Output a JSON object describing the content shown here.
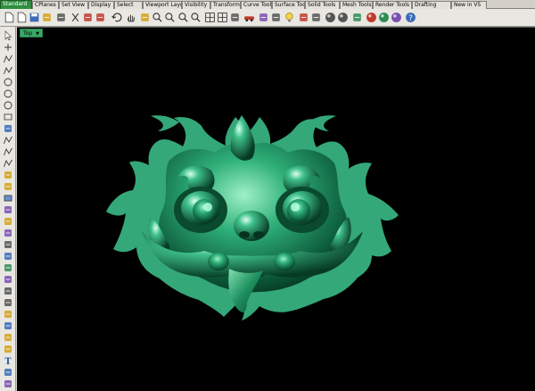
{
  "tabs": [
    {
      "label": "Standard",
      "active": true
    },
    {
      "label": "CPlanes",
      "active": false
    },
    {
      "label": "Set View",
      "active": false
    },
    {
      "label": "Display",
      "active": false
    },
    {
      "label": "Select",
      "active": false
    },
    {
      "label": "Viewport Layout",
      "active": false
    },
    {
      "label": "Visibility",
      "active": false
    },
    {
      "label": "Transform",
      "active": false
    },
    {
      "label": "Curve Tools",
      "active": false
    },
    {
      "label": "Surface Tools",
      "active": false
    },
    {
      "label": "Solid Tools",
      "active": false
    },
    {
      "label": "Mesh Tools",
      "active": false
    },
    {
      "label": "Render Tools",
      "active": false
    },
    {
      "label": "Drafting",
      "active": false
    },
    {
      "label": "New in V5",
      "active": false
    }
  ],
  "toolbar_icons": [
    "new-file-icon",
    "open-file-icon",
    "save-icon",
    "print-icon",
    "import-icon",
    "cut-icon",
    "copy-icon",
    "paste-icon",
    "undo-icon",
    "pan-hand-icon",
    "rotate-view-icon",
    "zoom-dynamic-icon",
    "zoom-window-icon",
    "zoom-extents-icon",
    "zoom-selected-icon",
    "four-viewports-icon",
    "grid-icon",
    "cplane-icon",
    "car-icon",
    "snap-icon",
    "layer-icon",
    "light-bulb-icon",
    "properties-icon",
    "lock-icon",
    "rendered-sphere-icon",
    "material-sphere-icon",
    "render-icon",
    "shaded-sphere-icon",
    "ghosted-sphere-icon",
    "xray-sphere-icon",
    "help-icon"
  ],
  "left_icons": [
    "select-arrow-icon",
    "point-icon",
    "polyline-icon",
    "curve-icon",
    "circle-icon",
    "arc-icon",
    "ellipse-icon",
    "rectangle-icon",
    "polygon-icon",
    "freeform-icon",
    "fillet-curve-icon",
    "offset-curve-icon",
    "surface-icon",
    "extrude-icon",
    "box-solid-icon",
    "cylinder-icon",
    "mesh-icon",
    "boolean-icon",
    "explode-icon",
    "join-icon",
    "trim-icon",
    "split-icon",
    "move-icon",
    "copy-object-icon",
    "rotate-icon",
    "scale-icon",
    "mirror-icon",
    "array-icon",
    "text-icon",
    "dimension-icon",
    "analyze-icon"
  ],
  "viewport": {
    "name": "Top",
    "model_color": "#2fa574",
    "background": "#000000"
  }
}
